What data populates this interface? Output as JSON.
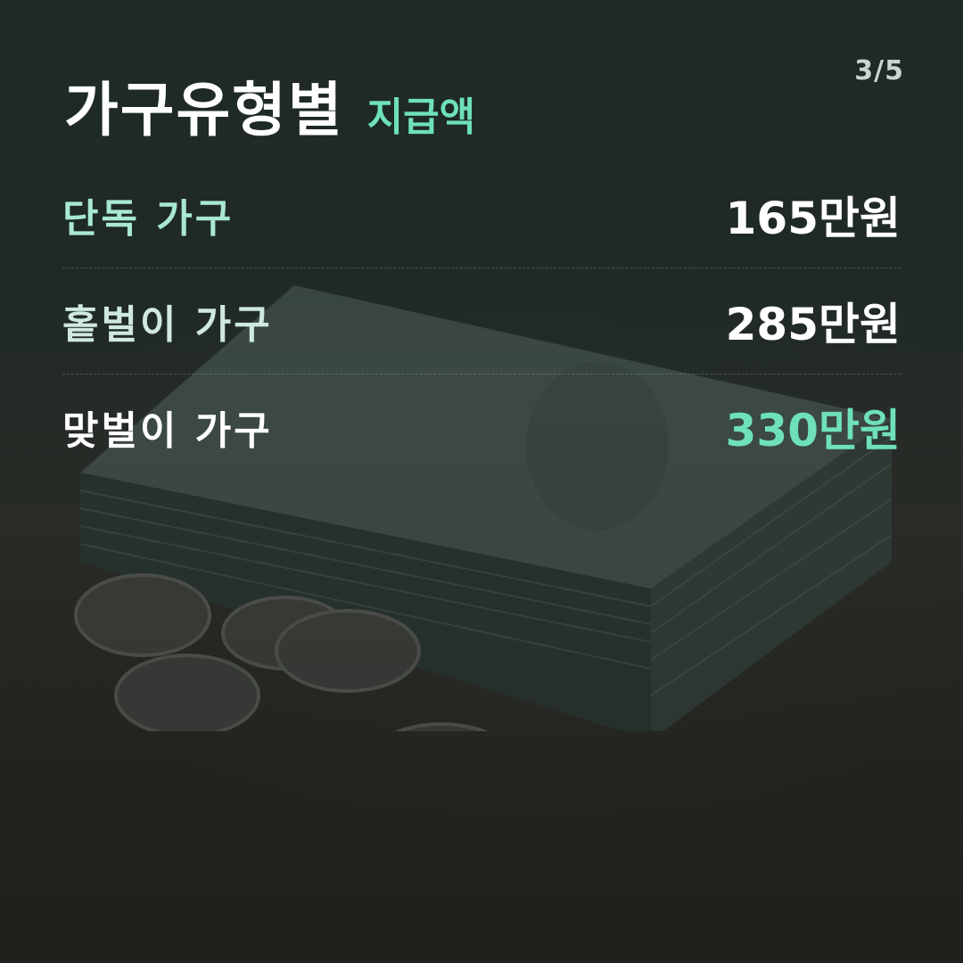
{
  "page_indicator": "3/5",
  "title": {
    "main": "가구유형별",
    "sub": "지급액"
  },
  "rows": [
    {
      "label": "단독 가구",
      "value": "165만원",
      "label_color": "#a9e8d4",
      "value_color": "#ffffff"
    },
    {
      "label": "홑벌이 가구",
      "value": "285만원",
      "label_color": "#cfe9e0",
      "value_color": "#ffffff"
    },
    {
      "label": "맞벌이 가구",
      "value": "330만원",
      "label_color": "#ffffff",
      "value_color": "#6ee0bc"
    }
  ],
  "colors": {
    "accent": "#6ee0bc",
    "text": "#ffffff"
  }
}
